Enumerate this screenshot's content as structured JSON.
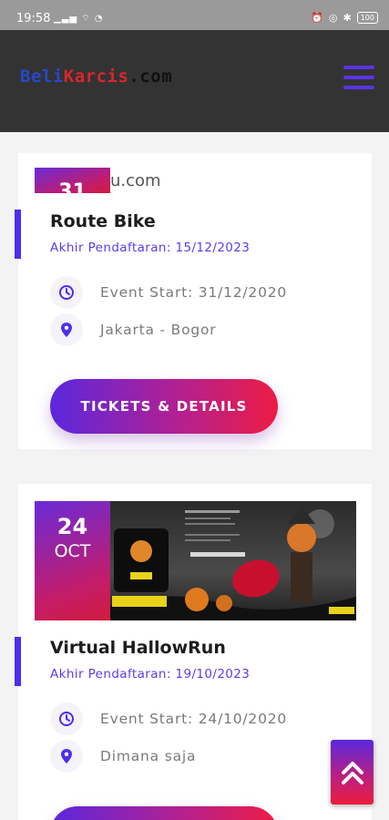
{
  "status_bar": {
    "time": "19:58",
    "battery": "100"
  },
  "header": {
    "logo": {
      "part1": "Beli",
      "part2": "Karcis",
      "part3": ".com"
    }
  },
  "events": [
    {
      "date_day": "31",
      "image_caption": "u.com",
      "title": "Route Bike",
      "registration_deadline": "Akhir Pendaftaran: 15/12/2023",
      "event_start": "Event Start: 31/12/2020",
      "location": "Jakarta - Bogor",
      "button_label": "TICKETS & DETAILS"
    },
    {
      "date_day": "24",
      "date_month": "OCT",
      "title": "Virtual HallowRun",
      "registration_deadline": "Akhir Pendaftaran: 19/10/2023",
      "event_start": "Event Start: 24/10/2020",
      "location": "Dimana saja"
    }
  ],
  "colors": {
    "accent": "#5b34e6",
    "gradient_start": "#5b27de",
    "gradient_end": "#ee1c43",
    "header_bg": "#333333"
  },
  "icons": {
    "event_start": "clock-icon",
    "location": "location-pin-icon",
    "menu": "hamburger-menu-icon",
    "scroll_top": "double-chevron-up-icon"
  }
}
